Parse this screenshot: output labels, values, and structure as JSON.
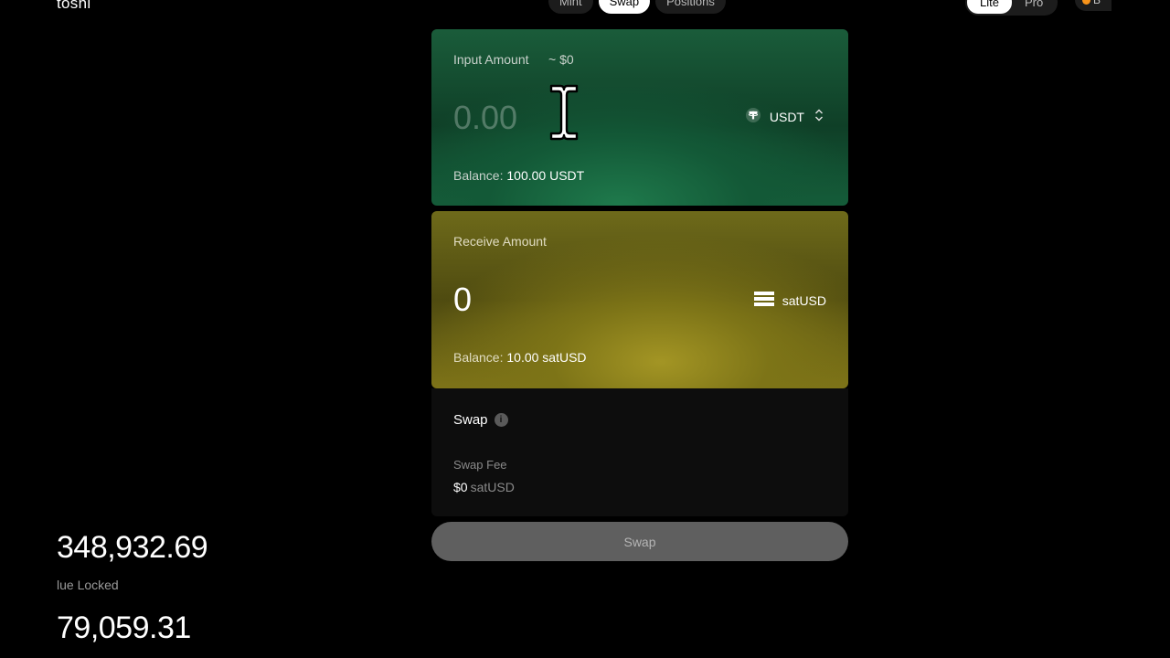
{
  "header": {
    "brand": "toshi",
    "nav_tabs": [
      {
        "label": "Mint",
        "active": false
      },
      {
        "label": "Swap",
        "active": true
      },
      {
        "label": "Positions",
        "active": false
      }
    ],
    "mode_options": [
      {
        "label": "Lite",
        "active": true
      },
      {
        "label": "Pro",
        "active": false
      }
    ],
    "wallet_chip": "B"
  },
  "stats": {
    "first_value": "348,932.69",
    "first_label": "lue Locked",
    "second_value": "79,059.31"
  },
  "input_card": {
    "label": "Input Amount",
    "usd_hint": "~ $0",
    "placeholder": "0.00",
    "token": "USDT",
    "token_icon": "tether-icon",
    "balance_label": "Balance:",
    "balance_value": "100.00 USDT",
    "accent_color": "#1f7a4c"
  },
  "receive_card": {
    "label": "Receive Amount",
    "amount": "0",
    "token": "satUSD",
    "token_icon": "satusd-icon",
    "balance_label": "Balance:",
    "balance_value": "10.00 satUSD",
    "accent_color": "#a39524"
  },
  "swap_section": {
    "title": "Swap",
    "fee_label": "Swap Fee",
    "fee_value": "$0",
    "fee_unit": "satUSD"
  },
  "swap_button": {
    "label": "Swap",
    "color": "#5f5f5f"
  }
}
